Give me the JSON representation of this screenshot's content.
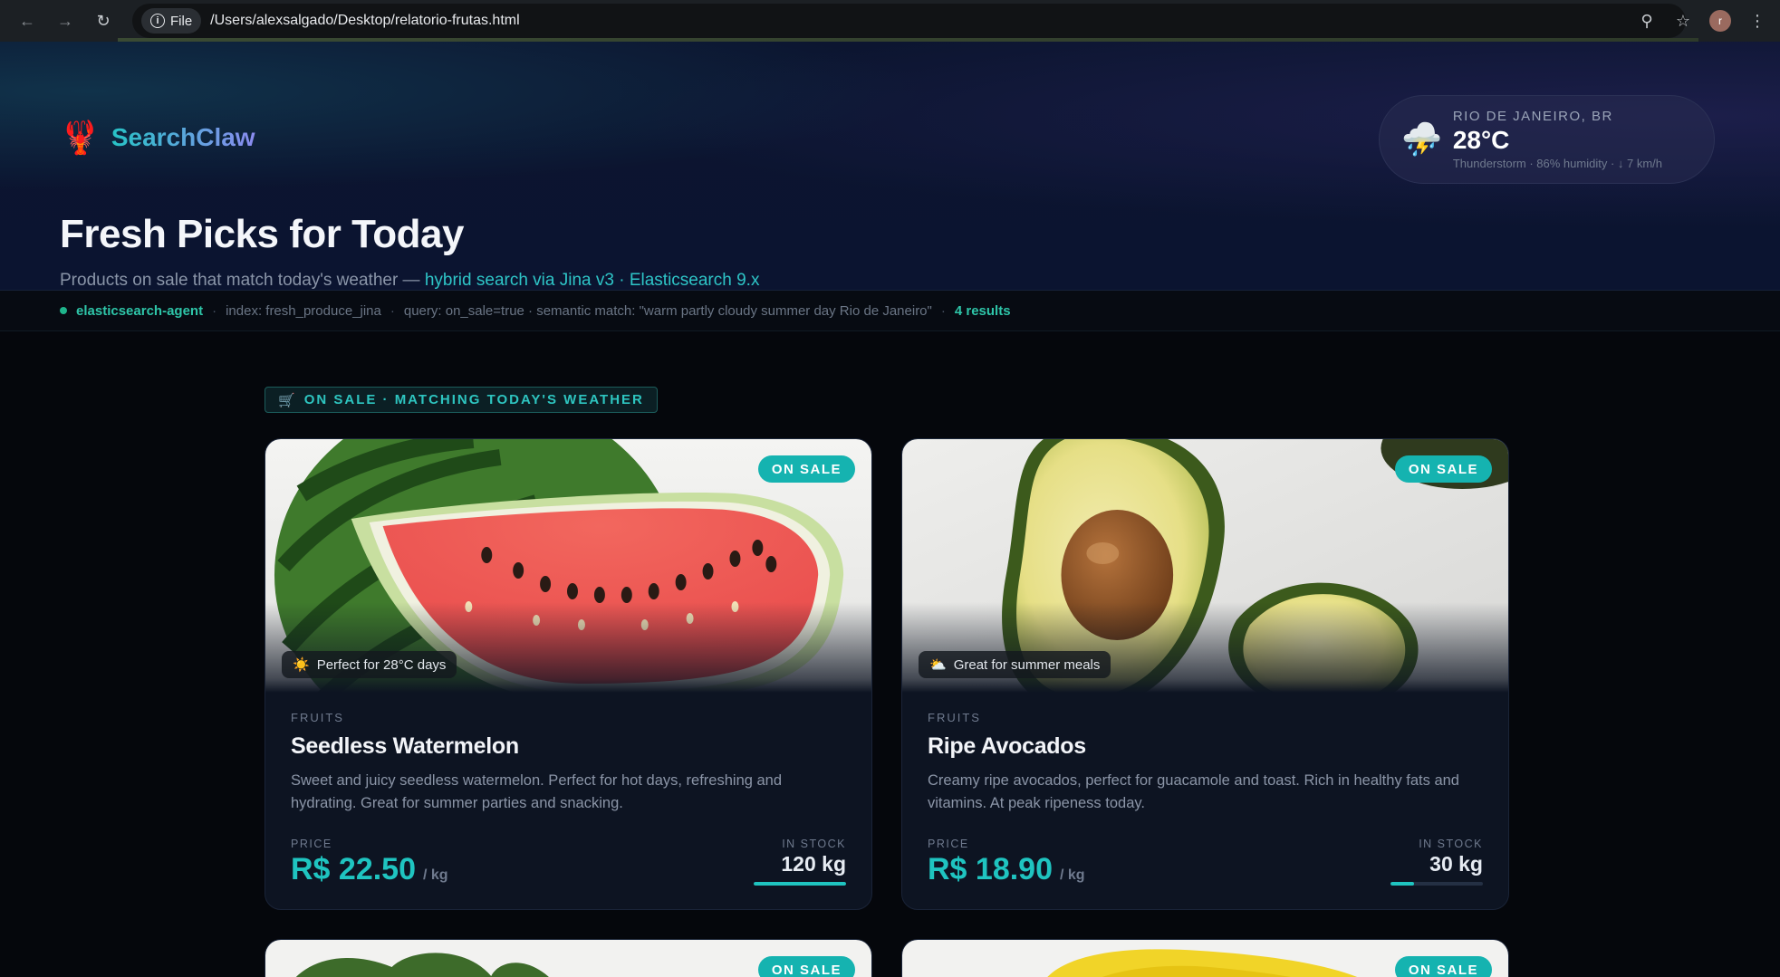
{
  "browser": {
    "chip_label": "File",
    "url": "/Users/alexsalgado/Desktop/relatorio-frutas.html",
    "avatar_letter": "r"
  },
  "brand": {
    "icon": "lobster-icon",
    "name": "SearchClaw"
  },
  "hero": {
    "title": "Fresh Picks for Today",
    "subtitle_prefix": "Products on sale that match today's weather — ",
    "subtitle_highlight": "hybrid search via Jina v3 · Elasticsearch 9.x"
  },
  "weather": {
    "icon": "thunderstorm-icon",
    "city": "RIO DE JANEIRO, BR",
    "temp": "28°C",
    "desc": "Thunderstorm · 86% humidity · ↓ 7 km/h"
  },
  "agent_bar": {
    "agent": "elasticsearch-agent",
    "index": "index: fresh_produce_jina",
    "query": "query: on_sale=true · semantic match: \"warm partly cloudy summer day Rio de Janeiro\"",
    "results": "4 results"
  },
  "section": {
    "icon": "cart-icon",
    "label": "ON SALE · MATCHING TODAY'S WEATHER"
  },
  "products": [
    {
      "badge": "ON SALE",
      "weather_tag": "Perfect for 28°C days",
      "weather_tag_icon": "sun-icon",
      "category": "FRUITS",
      "name": "Seedless Watermelon",
      "description": "Sweet and juicy seedless watermelon. Perfect for hot days, refreshing and hydrating. Great for summer parties and snacking.",
      "price_label": "PRICE",
      "price": "R$ 22.50",
      "unit": "/ kg",
      "stock_label": "IN STOCK",
      "stock": "120 kg",
      "stock_level": 1.0
    },
    {
      "badge": "ON SALE",
      "weather_tag": "Great for summer meals",
      "weather_tag_icon": "sun-behind-cloud-icon",
      "category": "FRUITS",
      "name": "Ripe Avocados",
      "description": "Creamy ripe avocados, perfect for guacamole and toast. Rich in healthy fats and vitamins. At peak ripeness today.",
      "price_label": "PRICE",
      "price": "R$ 18.90",
      "unit": "/ kg",
      "stock_label": "IN STOCK",
      "stock": "30 kg",
      "stock_level": 0.25
    },
    {
      "badge": "ON SALE"
    },
    {
      "badge": "ON SALE"
    }
  ]
}
